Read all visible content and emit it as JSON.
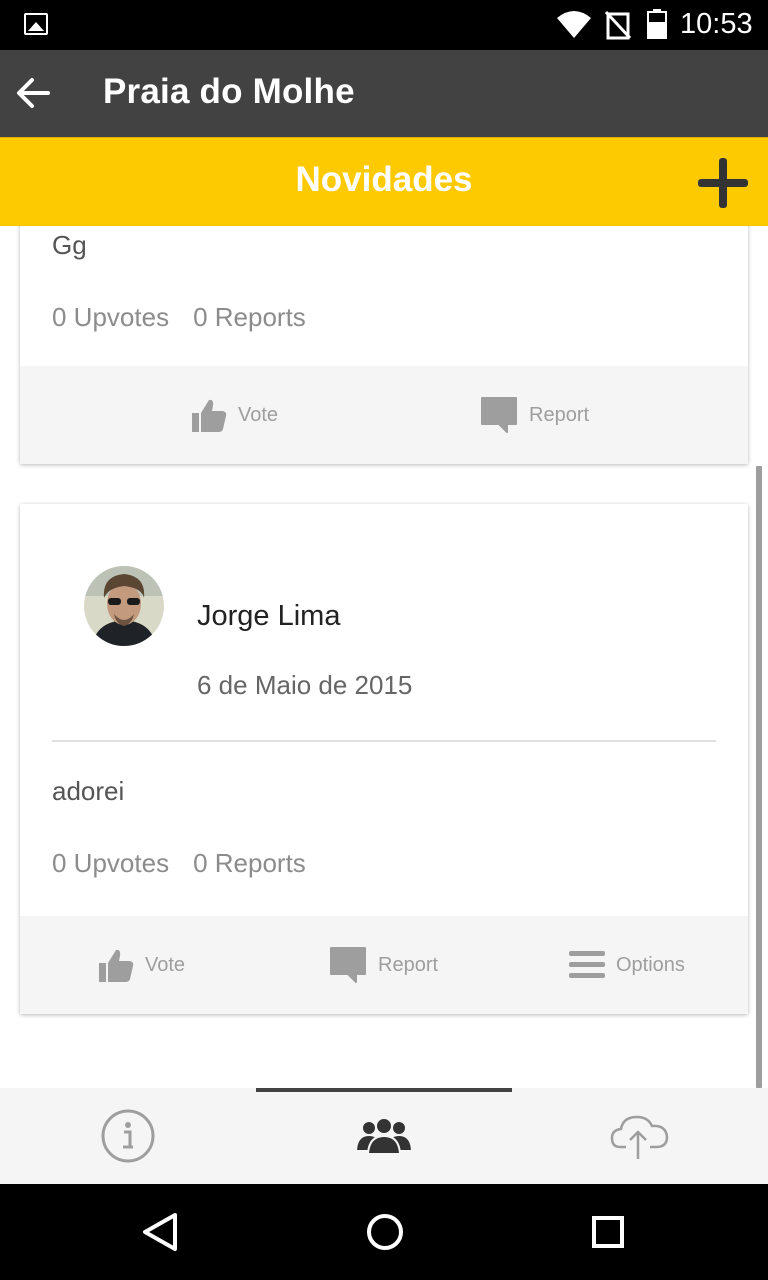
{
  "status_bar": {
    "time": "10:53",
    "icons": [
      "image-icon",
      "wifi-icon",
      "no-signal-icon",
      "battery-icon"
    ]
  },
  "app_bar": {
    "title": "Praia do Molhe",
    "back_icon": "arrow-left-icon"
  },
  "sub_header": {
    "title": "Novidades",
    "add_icon": "plus-icon"
  },
  "posts": [
    {
      "text": "Gg",
      "upvotes": "0 Upvotes",
      "reports": "0 Reports",
      "actions": {
        "vote": "Vote",
        "report": "Report"
      }
    },
    {
      "author": "Jorge Lima",
      "date": "6 de Maio de 2015",
      "text": "adorei",
      "upvotes": "0 Upvotes",
      "reports": "0 Reports",
      "actions": {
        "vote": "Vote",
        "report": "Report",
        "options": "Options"
      }
    }
  ],
  "tabs": [
    {
      "icon": "info-icon",
      "active": false
    },
    {
      "icon": "people-icon",
      "active": true
    },
    {
      "icon": "cloud-upload-icon",
      "active": false
    }
  ],
  "nav_bar": {
    "icons": [
      "back-triangle-icon",
      "home-circle-icon",
      "recents-square-icon"
    ]
  },
  "colors": {
    "accent": "#fdc900",
    "app_bar": "#424242",
    "action_gray": "#9e9e9e"
  }
}
